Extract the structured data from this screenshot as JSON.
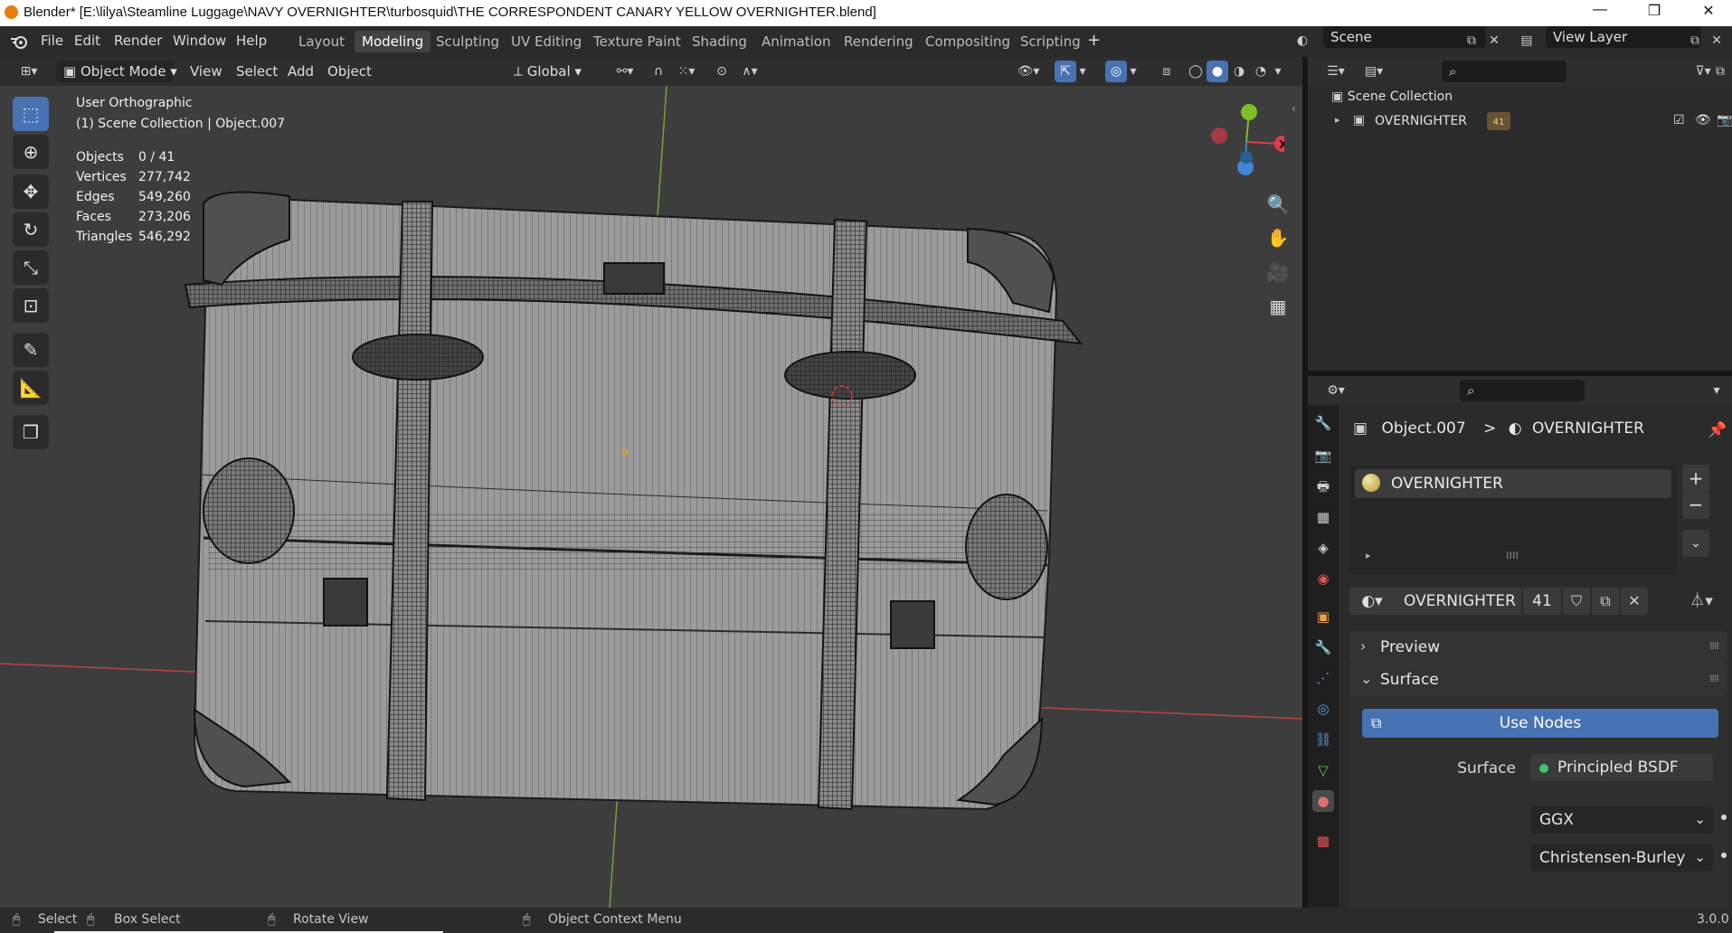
{
  "titlebar": {
    "title": "Blender* [E:\\lilya\\Steamline Luggage\\NAVY OVERNIGHTER\\turbosquid\\THE CORRESPONDENT CANARY YELLOW OVERNIGHTER.blend]",
    "minimize": "—",
    "restore": "❐",
    "close": "✕"
  },
  "menu": {
    "items": [
      "File",
      "Edit",
      "Render",
      "Window",
      "Help"
    ]
  },
  "workspaces": [
    "Layout",
    "Modeling",
    "Sculpting",
    "UV Editing",
    "Texture Paint",
    "Shading",
    "Animation",
    "Rendering",
    "Compositing",
    "Scripting"
  ],
  "add_workspace": "+",
  "scene": {
    "name": "Scene"
  },
  "view_layer": {
    "name": "View Layer"
  },
  "viewport_header": {
    "mode": "Object Mode",
    "menus": [
      "View",
      "Select",
      "Add",
      "Object"
    ],
    "orientation": "Global"
  },
  "viewport": {
    "view_name": "User Orthographic",
    "collection_info": "(1) Scene Collection | Object.007",
    "stats": [
      {
        "label": "Objects",
        "value": "0 / 41"
      },
      {
        "label": "Vertices",
        "value": "277,742"
      },
      {
        "label": "Edges",
        "value": "549,260"
      },
      {
        "label": "Faces",
        "value": "273,206"
      },
      {
        "label": "Triangles",
        "value": "546,292"
      }
    ],
    "gizmo_x_label": "X"
  },
  "outliner": {
    "root": "Scene Collection",
    "items": [
      {
        "name": "OVERNIGHTER",
        "badge": "41"
      }
    ]
  },
  "properties": {
    "breadcrumb_object": "Object.007",
    "breadcrumb_separator": ">",
    "breadcrumb_material": "OVERNIGHTER",
    "slot_name": "OVERNIGHTER",
    "material_name": "OVERNIGHTER",
    "material_users": "41",
    "panels": {
      "preview": "Preview",
      "surface": "Surface"
    },
    "use_nodes": "Use Nodes",
    "surface_label": "Surface",
    "surface_value": "Principled BSDF",
    "distribution": "GGX",
    "subsurface_method": "Christensen-Burley"
  },
  "statusbar": {
    "select": "Select",
    "box_select": "Box Select",
    "rotate_view": "Rotate View",
    "context_menu": "Object Context Menu",
    "version": "3.0.0"
  },
  "colors": {
    "accent_blue": "#4772b3",
    "gizmo_x": "#e33a4a",
    "gizmo_y": "#7dbe2a",
    "gizmo_z": "#3f86d4",
    "axis_red": "#c44848",
    "axis_green": "#78b93a"
  }
}
